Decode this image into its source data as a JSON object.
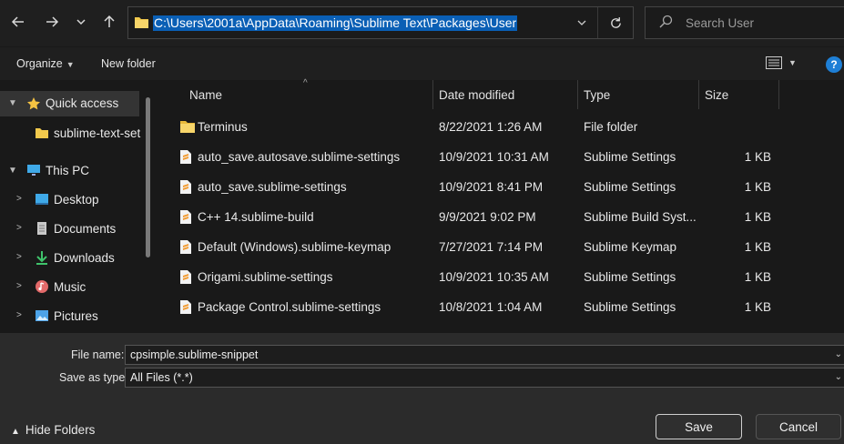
{
  "nav_buttons": {
    "back_icon": "arrow-left-icon",
    "forward_icon": "arrow-right-icon",
    "recent_icon": "chevron-down-icon",
    "up_icon": "arrow-up-icon"
  },
  "address": {
    "path": "C:\\Users\\2001a\\AppData\\Roaming\\Sublime Text\\Packages\\User"
  },
  "search": {
    "placeholder": "Search User"
  },
  "toolbar": {
    "organize_label": "Organize",
    "new_folder_label": "New folder"
  },
  "nav_pane": {
    "quick_access": "Quick access",
    "sublime_text_set": "sublime-text-set",
    "this_pc": "This PC",
    "desktop": "Desktop",
    "documents": "Documents",
    "downloads": "Downloads",
    "music": "Music",
    "pictures": "Pictures"
  },
  "columns": {
    "name": "Name",
    "date_modified": "Date modified",
    "type": "Type",
    "size": "Size"
  },
  "files": [
    {
      "name": "Terminus",
      "date": "8/22/2021 1:26 AM",
      "type": "File folder",
      "size": "",
      "icon": "folder-icon"
    },
    {
      "name": "auto_save.autosave.sublime-settings",
      "date": "10/9/2021 10:31 AM",
      "type": "Sublime Settings",
      "size": "1 KB",
      "icon": "sublime-file-icon"
    },
    {
      "name": "auto_save.sublime-settings",
      "date": "10/9/2021 8:41 PM",
      "type": "Sublime Settings",
      "size": "1 KB",
      "icon": "sublime-file-icon"
    },
    {
      "name": "C++ 14.sublime-build",
      "date": "9/9/2021 9:02 PM",
      "type": "Sublime Build Syst...",
      "size": "1 KB",
      "icon": "sublime-file-icon"
    },
    {
      "name": "Default (Windows).sublime-keymap",
      "date": "7/27/2021 7:14 PM",
      "type": "Sublime Keymap",
      "size": "1 KB",
      "icon": "sublime-file-icon"
    },
    {
      "name": "Origami.sublime-settings",
      "date": "10/9/2021 10:35 AM",
      "type": "Sublime Settings",
      "size": "1 KB",
      "icon": "sublime-file-icon"
    },
    {
      "name": "Package Control.sublime-settings",
      "date": "10/8/2021 1:04 AM",
      "type": "Sublime Settings",
      "size": "1 KB",
      "icon": "sublime-file-icon"
    }
  ],
  "bottom": {
    "file_name_label": "File name:",
    "file_name_value": "cpsimple.sublime-snippet",
    "save_as_type_label": "Save as type:",
    "save_as_type_value": "All Files (*.*)",
    "hide_folders": "Hide Folders",
    "save_label": "Save",
    "cancel_label": "Cancel"
  },
  "colors": {
    "accent": "#1e7fd6",
    "selection": "#0a5fb5",
    "folder": "#f2c94c"
  }
}
